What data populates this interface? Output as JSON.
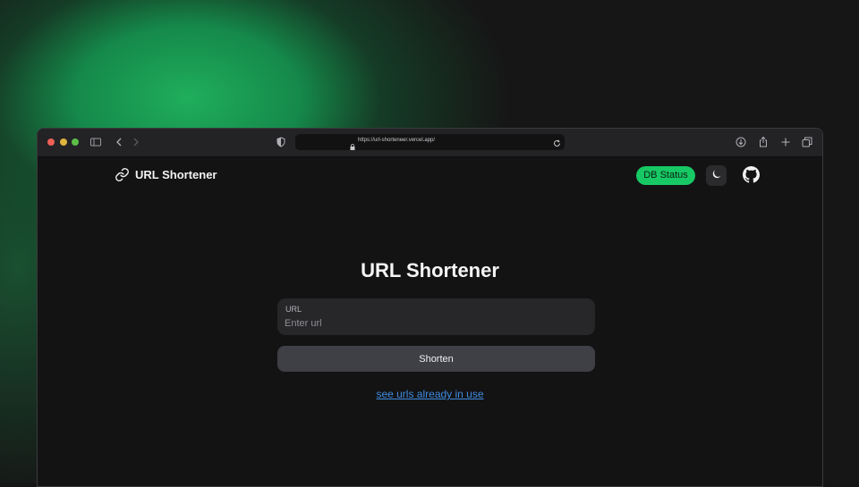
{
  "browser": {
    "url": "https://url-shorteneer.vercel.app/",
    "icons": [
      "sidebar-icon",
      "back-icon",
      "forward-icon",
      "shield-icon",
      "lock-icon",
      "reload-icon",
      "download-icon",
      "share-icon",
      "new-tab-icon",
      "tabs-overview-icon"
    ]
  },
  "navbar": {
    "brand": "URL Shortener",
    "db_status": "DB Status",
    "theme_icon": "moon-icon",
    "github_icon": "github-icon"
  },
  "main": {
    "title": "URL Shortener",
    "url_label": "URL",
    "url_placeholder": "Enter url",
    "url_value": "",
    "submit_label": "Shorten",
    "link_text": "see urls already in use"
  },
  "colors": {
    "accent_green": "#17c964",
    "link_blue": "#3f8be0",
    "background": "#131314"
  }
}
